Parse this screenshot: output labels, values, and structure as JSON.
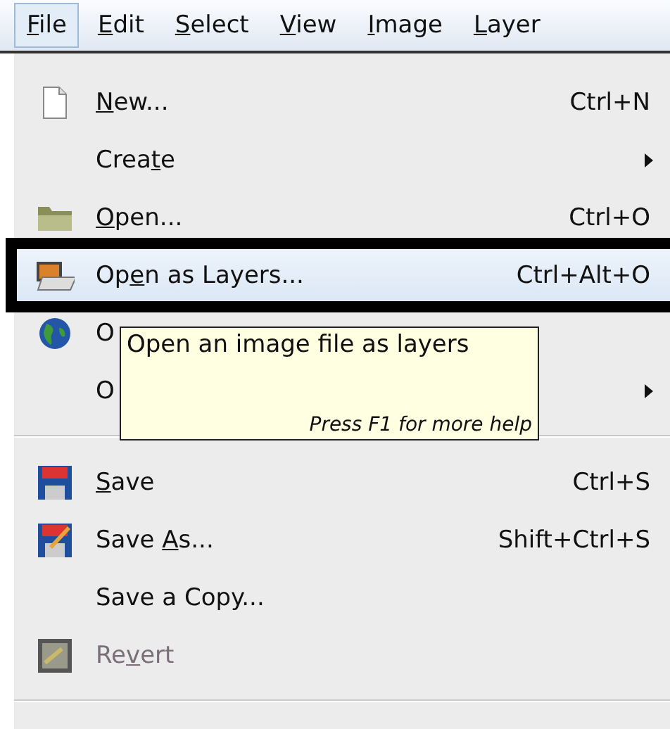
{
  "menubar": [
    {
      "key": "F",
      "post": "ile",
      "selected": true
    },
    {
      "key": "E",
      "post": "dit",
      "selected": false
    },
    {
      "key": "S",
      "post": "elect",
      "selected": false
    },
    {
      "key": "V",
      "post": "iew",
      "selected": false
    },
    {
      "key": "I",
      "post": "mage",
      "selected": false
    },
    {
      "key": "L",
      "post": "ayer",
      "selected": false
    }
  ],
  "menu": [
    {
      "kind": "item",
      "key": "N",
      "post": "ew...",
      "shortcut": "Ctrl+N",
      "submenu": false,
      "selected": false,
      "disabled": false
    },
    {
      "kind": "item",
      "pre": "Crea",
      "key": "t",
      "post": "e",
      "submenu": true,
      "selected": false,
      "disabled": false
    },
    {
      "kind": "item",
      "key": "O",
      "post": "pen...",
      "shortcut": "Ctrl+O",
      "submenu": false,
      "selected": false,
      "disabled": false
    },
    {
      "kind": "item",
      "pre": "Op",
      "key": "e",
      "post": "n as Layers...",
      "shortcut": "Ctrl+Alt+O",
      "submenu": false,
      "selected": true,
      "disabled": false
    },
    {
      "kind": "item",
      "pre": "O",
      "submenu": false,
      "selected": false,
      "disabled": false
    },
    {
      "kind": "item",
      "pre": "O",
      "submenu": true,
      "selected": false,
      "disabled": false
    },
    {
      "kind": "separator"
    },
    {
      "kind": "item",
      "key": "S",
      "post": "ave",
      "shortcut": "Ctrl+S",
      "submenu": false,
      "selected": false,
      "disabled": false
    },
    {
      "kind": "item",
      "pre": "Save ",
      "key": "A",
      "post": "s...",
      "shortcut": "Shift+Ctrl+S",
      "submenu": false,
      "selected": false,
      "disabled": false
    },
    {
      "kind": "item",
      "pre": "Save a Copy...",
      "submenu": false,
      "selected": false,
      "disabled": false
    },
    {
      "kind": "item",
      "pre": "Re",
      "key": "v",
      "post": "ert",
      "submenu": false,
      "selected": false,
      "disabled": true
    },
    {
      "kind": "separator"
    }
  ],
  "tooltip": {
    "text": "Open an image file as layers",
    "hint": "Press F1 for more help"
  }
}
